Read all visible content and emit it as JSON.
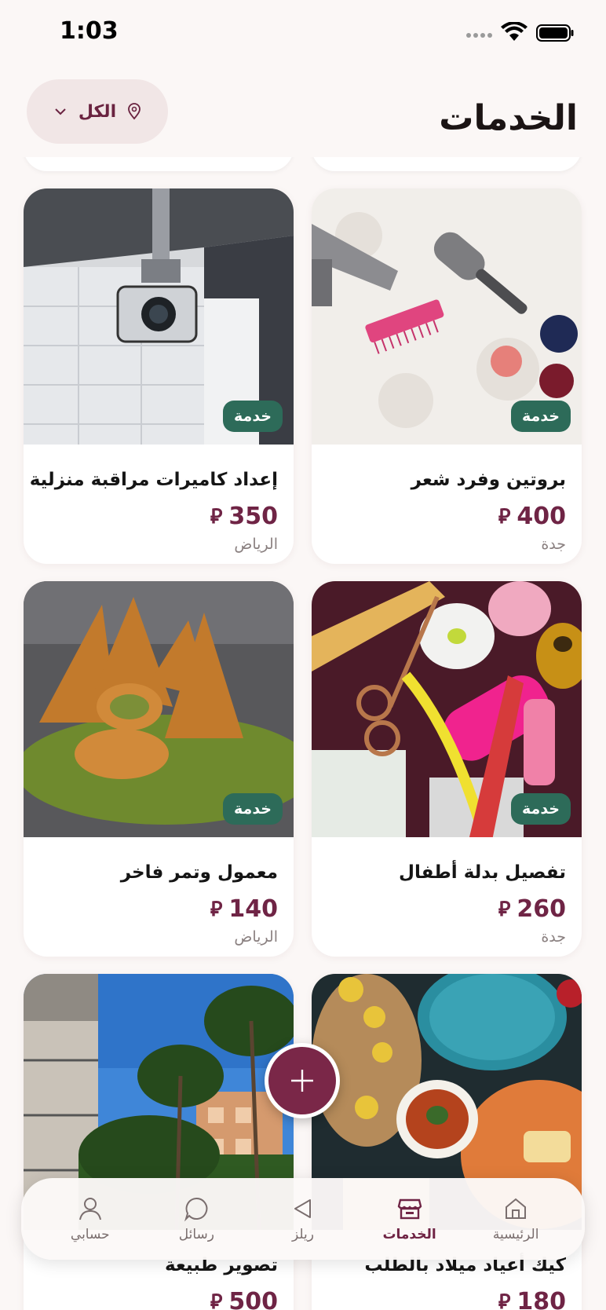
{
  "status_bar": {
    "time": "1:03"
  },
  "header": {
    "title": "الخدمات",
    "location_filter": "الكل"
  },
  "cards": [
    {
      "title": "إعداد كاميرات مراقبة منزلية",
      "price": "350",
      "city": "الرياض",
      "badge": "خدمة"
    },
    {
      "title": "بروتين وفرد شعر",
      "price": "400",
      "city": "جدة",
      "badge": "خدمة"
    },
    {
      "title": "معمول وتمر فاخر",
      "price": "140",
      "city": "الرياض",
      "badge": "خدمة"
    },
    {
      "title": "تفصيل بدلة أطفال",
      "price": "260",
      "city": "جدة",
      "badge": "خدمة"
    },
    {
      "title": "تصوير طبيعة",
      "price": "500",
      "city": ""
    },
    {
      "title": "كيك أعياد ميلاد بالطلب",
      "price": "180",
      "city": ""
    }
  ],
  "currency_symbol": "⃁",
  "tabs": [
    {
      "label": "الرئيسية",
      "icon": "home-icon"
    },
    {
      "label": "الخدمات",
      "icon": "store-icon",
      "active": true
    },
    {
      "label": "ريلز",
      "icon": "play-icon"
    },
    {
      "label": "رسائل",
      "icon": "chat-icon"
    },
    {
      "label": "حسابي",
      "icon": "user-icon"
    }
  ],
  "colors": {
    "accent": "#6f2445",
    "badge": "#2d6b59",
    "background": "#fbf7f6"
  }
}
